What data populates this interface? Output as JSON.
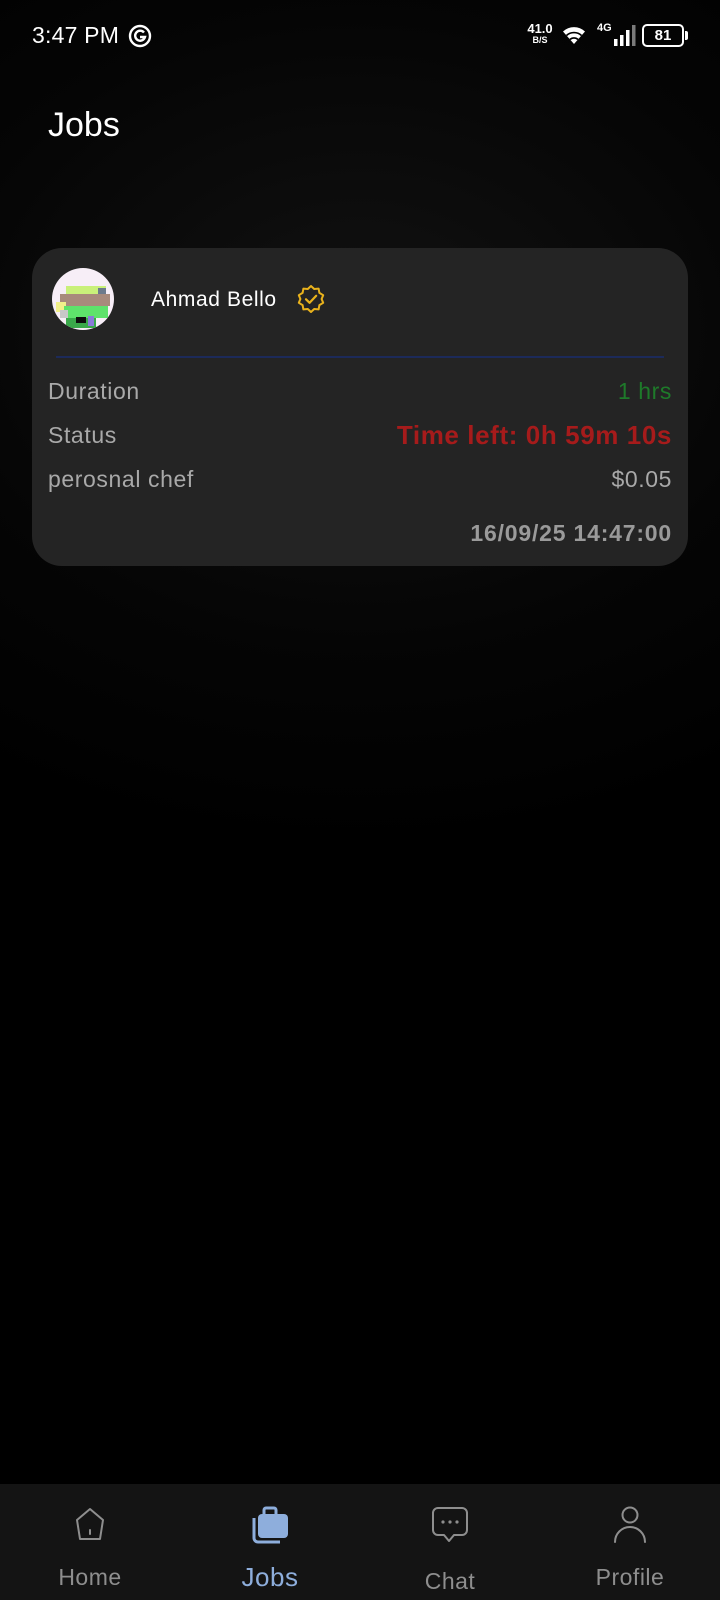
{
  "status_bar": {
    "time": "3:47 PM",
    "net_speed": "41.0",
    "net_speed_unit": "B/S",
    "network_type": "4G",
    "battery": "81",
    "icons": [
      "vpn-app-icon",
      "wifi-icon",
      "signal-icon",
      "battery-icon"
    ]
  },
  "page": {
    "title": "Jobs"
  },
  "job_card": {
    "user_name": "Ahmad Bello",
    "verified_icon": "verified-badge-icon",
    "rows": [
      {
        "label": "Duration",
        "value": "1 hrs"
      },
      {
        "label": "Status",
        "value": "Time left: 0h 59m 10s"
      },
      {
        "label": "perosnal chef",
        "value": "$0.05"
      }
    ],
    "date": "16/09/25 14:47:00"
  },
  "bottom_nav": {
    "items": [
      {
        "label": "Home",
        "icon": "home-icon",
        "active": false
      },
      {
        "label": "Jobs",
        "icon": "briefcase-icon",
        "active": true
      },
      {
        "label": "Chat",
        "icon": "chat-icon",
        "active": false
      },
      {
        "label": "Profile",
        "icon": "profile-icon",
        "active": false
      }
    ]
  },
  "colors": {
    "background": "#000000",
    "card": "#242424",
    "duration_green": "#1e7a2a",
    "status_red": "#a61b1b",
    "verified_gold": "#e9b21c",
    "active_nav": "#8eaedc",
    "nav_bg": "#141414"
  }
}
